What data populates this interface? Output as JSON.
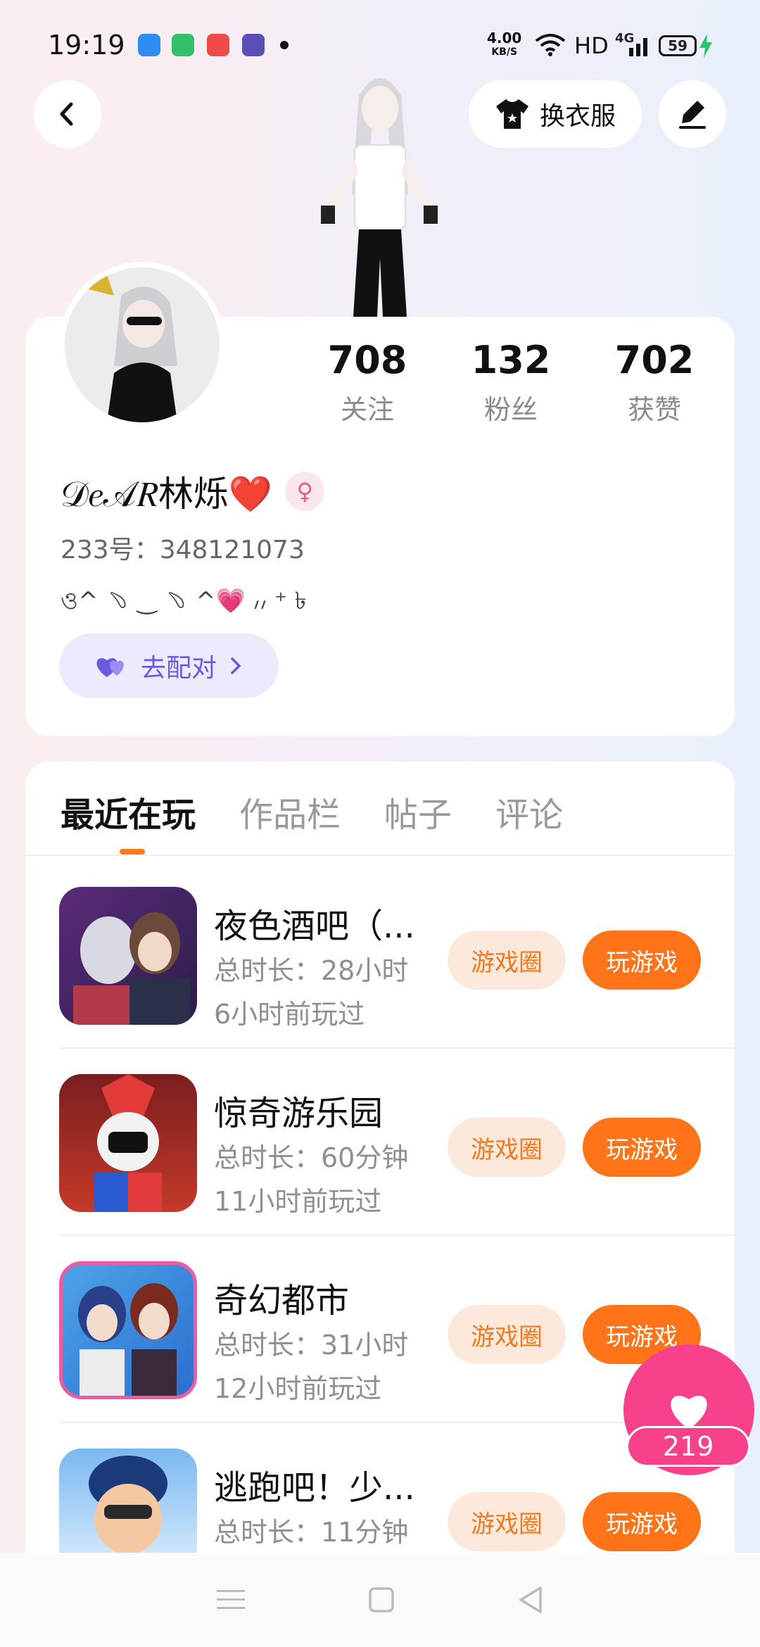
{
  "status_bar": {
    "time": "19:19",
    "net_speed_value": "4.00",
    "net_speed_unit": "KB/S",
    "hd": "HD",
    "signal": "4G",
    "battery": "59"
  },
  "header": {
    "dress_button": "换衣服"
  },
  "profile": {
    "stats": [
      {
        "value": "708",
        "label": "关注"
      },
      {
        "value": "132",
        "label": "粉丝"
      },
      {
        "value": "702",
        "label": "获赞"
      }
    ],
    "name": "𝒟𝑒𝒜𝑅林烁❤️",
    "uid": "233号：348121073",
    "bio": "ও^ ﹆ ‿ ﹆ ^💗 ៸៸ ⁺ ৳",
    "pair_button": "去配对"
  },
  "tabs": [
    "最近在玩",
    "作品栏",
    "帖子",
    "评论"
  ],
  "games": [
    {
      "title": "夜色酒吧（...",
      "duration": "总时长：28小时",
      "last_played": "6小时前玩过",
      "circle_label": "游戏圈",
      "play_label": "玩游戏"
    },
    {
      "title": "惊奇游乐园",
      "duration": "总时长：60分钟",
      "last_played": "11小时前玩过",
      "circle_label": "游戏圈",
      "play_label": "玩游戏"
    },
    {
      "title": "奇幻都市",
      "duration": "总时长：31小时",
      "last_played": "12小时前玩过",
      "circle_label": "游戏圈",
      "play_label": "玩游戏"
    },
    {
      "title": "逃跑吧！少...",
      "duration": "总时长：11分钟",
      "last_played": "",
      "circle_label": "游戏圈",
      "play_label": "玩游戏"
    }
  ],
  "like_fab": {
    "count": "219"
  },
  "colors": {
    "accent": "#ff7418",
    "pink": "#f7418a",
    "pair": "#6a5ae0"
  }
}
